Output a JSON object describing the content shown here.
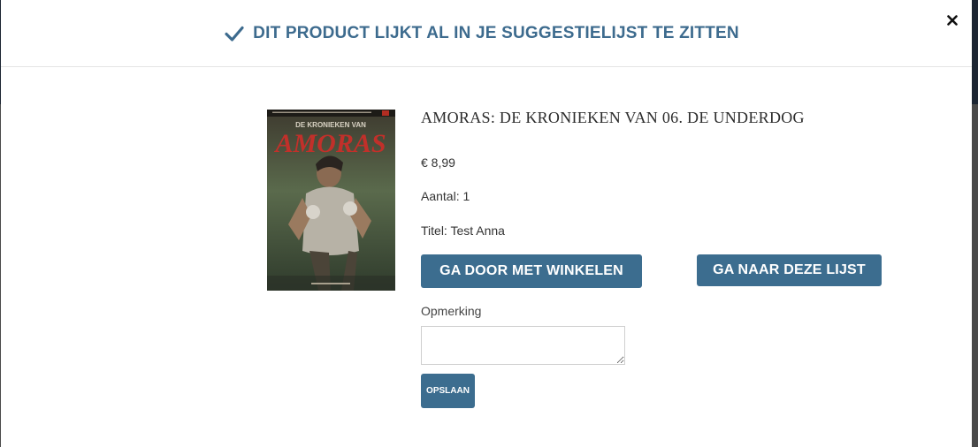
{
  "modal": {
    "header_title": "DIT PRODUCT LIJKT AL IN JE SUGGESTIELIJST TE ZITTEN",
    "close_icon": "close-icon",
    "check_icon": "check-icon"
  },
  "product": {
    "title": "AMORAS: DE KRONIEKEN VAN 06. DE UNDERDOG",
    "price": "€ 8,99",
    "quantity": "Aantal: 1",
    "list_title": "Titel: Test Anna",
    "cover": {
      "series_text": "DE KRONIEKEN VAN",
      "logo_text": "AMORAS"
    }
  },
  "actions": {
    "continue_label": "GA DOOR MET WINKELEN",
    "go_to_list_label": "GA NAAR DEZE LIJST"
  },
  "remark": {
    "label": "Opmerking",
    "value": "",
    "save_label": "OPSLAAN"
  },
  "colors": {
    "accent": "#3c6d8f",
    "header_text": "#3d6b8e"
  }
}
